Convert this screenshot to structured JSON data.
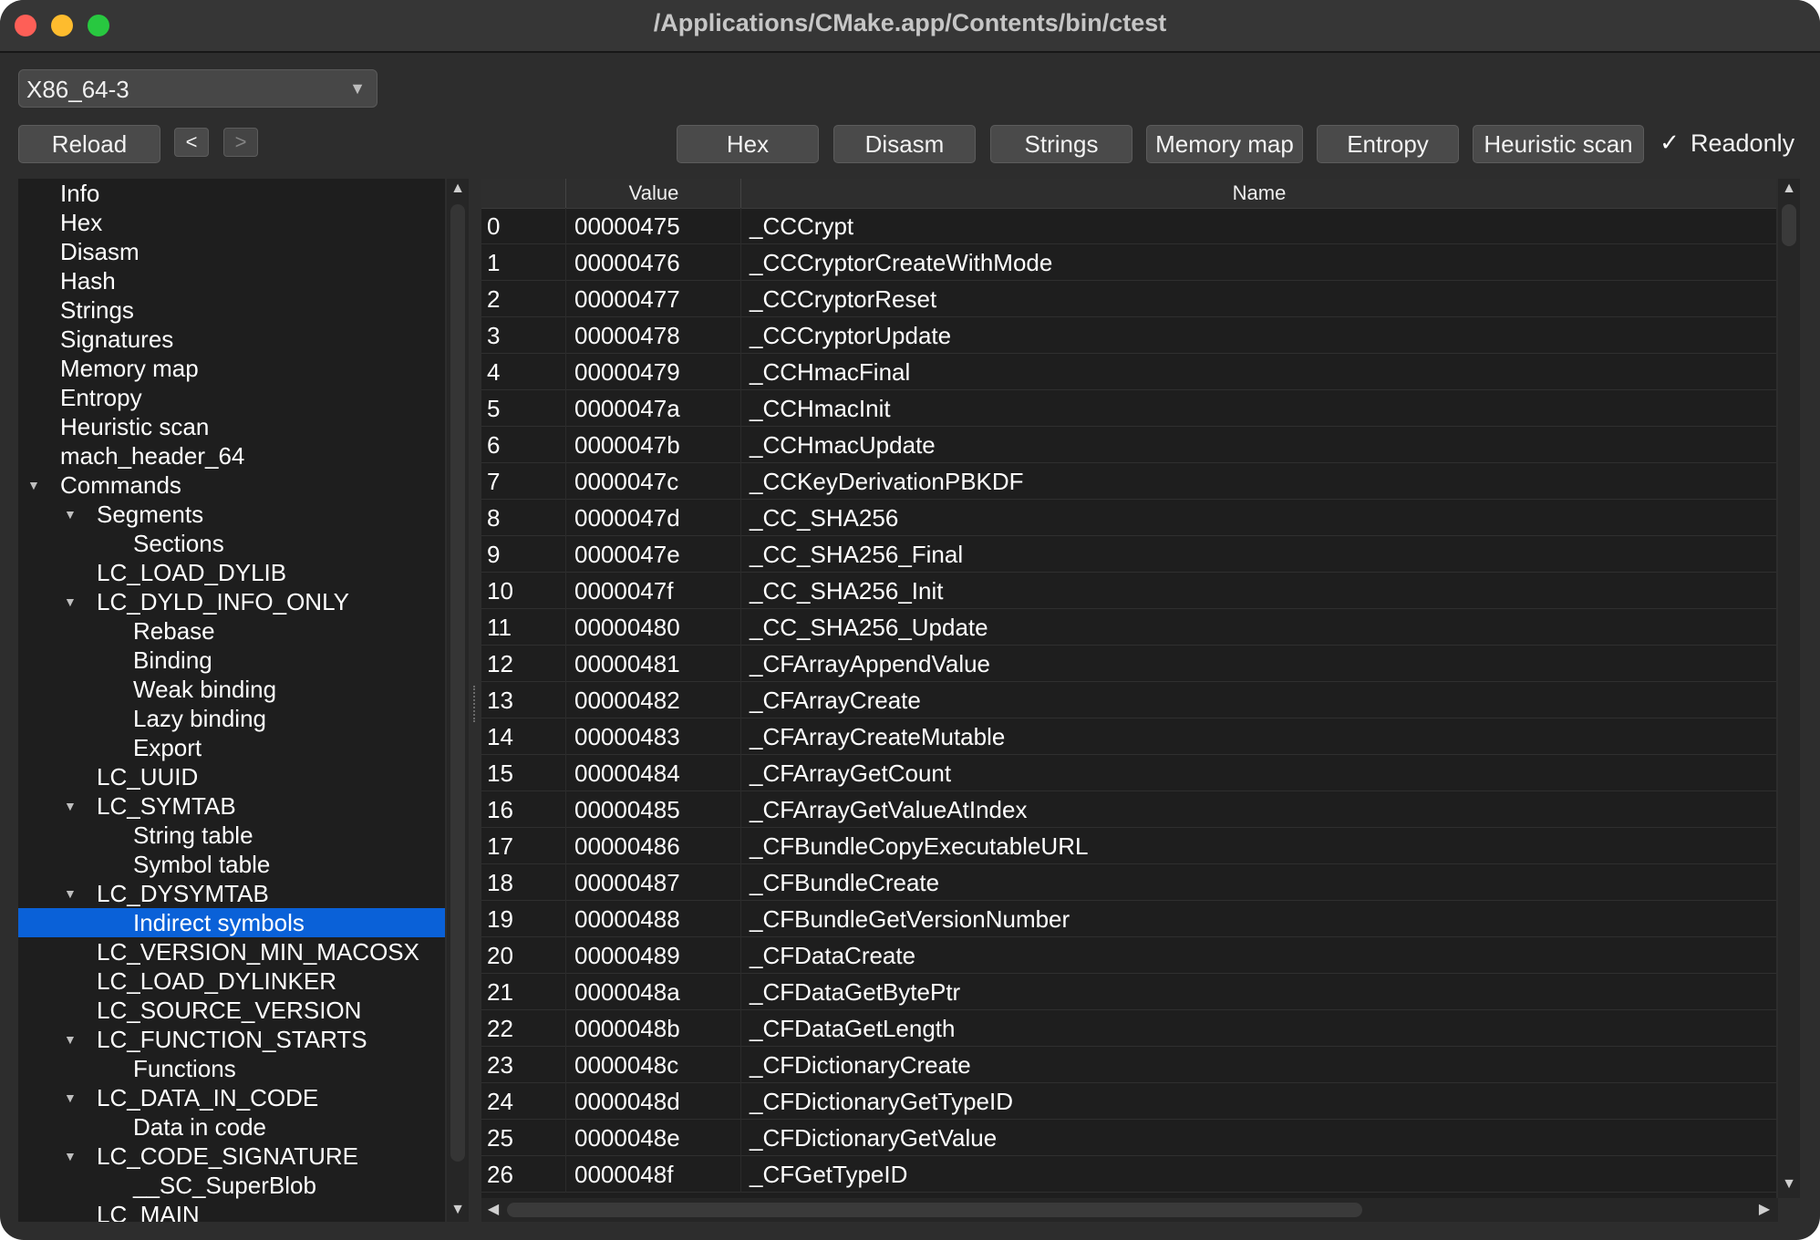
{
  "window": {
    "title": "/Applications/CMake.app/Contents/bin/ctest",
    "traffic_light_colors": [
      "#fe5f57",
      "#febc2e",
      "#28c840"
    ]
  },
  "toolbar": {
    "arch_select": "X86_64-3",
    "reload": "Reload",
    "back": "<",
    "forward": ">",
    "hex": "Hex",
    "disasm": "Disasm",
    "strings": "Strings",
    "memory_map": "Memory map",
    "entropy": "Entropy",
    "heuristic_scan": "Heuristic scan",
    "readonly_check": "✓",
    "readonly_label": "Readonly"
  },
  "tree": [
    {
      "label": "Info",
      "level": 0
    },
    {
      "label": "Hex",
      "level": 0
    },
    {
      "label": "Disasm",
      "level": 0
    },
    {
      "label": "Hash",
      "level": 0
    },
    {
      "label": "Strings",
      "level": 0
    },
    {
      "label": "Signatures",
      "level": 0
    },
    {
      "label": "Memory map",
      "level": 0
    },
    {
      "label": "Entropy",
      "level": 0
    },
    {
      "label": "Heuristic scan",
      "level": 0
    },
    {
      "label": "mach_header_64",
      "level": 0
    },
    {
      "label": "Commands",
      "level": 0,
      "expanded": true
    },
    {
      "label": "Segments",
      "level": 1,
      "expanded": true
    },
    {
      "label": "Sections",
      "level": 2
    },
    {
      "label": "LC_LOAD_DYLIB",
      "level": 1
    },
    {
      "label": "LC_DYLD_INFO_ONLY",
      "level": 1,
      "expanded": true
    },
    {
      "label": "Rebase",
      "level": 2
    },
    {
      "label": "Binding",
      "level": 2
    },
    {
      "label": "Weak binding",
      "level": 2
    },
    {
      "label": "Lazy binding",
      "level": 2
    },
    {
      "label": "Export",
      "level": 2
    },
    {
      "label": "LC_UUID",
      "level": 1
    },
    {
      "label": "LC_SYMTAB",
      "level": 1,
      "expanded": true
    },
    {
      "label": "String table",
      "level": 2
    },
    {
      "label": "Symbol table",
      "level": 2
    },
    {
      "label": "LC_DYSYMTAB",
      "level": 1,
      "expanded": true
    },
    {
      "label": "Indirect symbols",
      "level": 2,
      "selected": true
    },
    {
      "label": "LC_VERSION_MIN_MACOSX",
      "level": 1
    },
    {
      "label": "LC_LOAD_DYLINKER",
      "level": 1
    },
    {
      "label": "LC_SOURCE_VERSION",
      "level": 1
    },
    {
      "label": "LC_FUNCTION_STARTS",
      "level": 1,
      "expanded": true
    },
    {
      "label": "Functions",
      "level": 2
    },
    {
      "label": "LC_DATA_IN_CODE",
      "level": 1,
      "expanded": true
    },
    {
      "label": "Data in code",
      "level": 2
    },
    {
      "label": "LC_CODE_SIGNATURE",
      "level": 1,
      "expanded": true
    },
    {
      "label": "__SC_SuperBlob",
      "level": 2
    },
    {
      "label": "LC_MAIN",
      "level": 1
    }
  ],
  "table": {
    "columns": [
      "",
      "Value",
      "Name"
    ],
    "rows": [
      [
        "0",
        "00000475",
        "_CCCrypt"
      ],
      [
        "1",
        "00000476",
        "_CCCryptorCreateWithMode"
      ],
      [
        "2",
        "00000477",
        "_CCCryptorReset"
      ],
      [
        "3",
        "00000478",
        "_CCCryptorUpdate"
      ],
      [
        "4",
        "00000479",
        "_CCHmacFinal"
      ],
      [
        "5",
        "0000047a",
        "_CCHmacInit"
      ],
      [
        "6",
        "0000047b",
        "_CCHmacUpdate"
      ],
      [
        "7",
        "0000047c",
        "_CCKeyDerivationPBKDF"
      ],
      [
        "8",
        "0000047d",
        "_CC_SHA256"
      ],
      [
        "9",
        "0000047e",
        "_CC_SHA256_Final"
      ],
      [
        "10",
        "0000047f",
        "_CC_SHA256_Init"
      ],
      [
        "11",
        "00000480",
        "_CC_SHA256_Update"
      ],
      [
        "12",
        "00000481",
        "_CFArrayAppendValue"
      ],
      [
        "13",
        "00000482",
        "_CFArrayCreate"
      ],
      [
        "14",
        "00000483",
        "_CFArrayCreateMutable"
      ],
      [
        "15",
        "00000484",
        "_CFArrayGetCount"
      ],
      [
        "16",
        "00000485",
        "_CFArrayGetValueAtIndex"
      ],
      [
        "17",
        "00000486",
        "_CFBundleCopyExecutableURL"
      ],
      [
        "18",
        "00000487",
        "_CFBundleCreate"
      ],
      [
        "19",
        "00000488",
        "_CFBundleGetVersionNumber"
      ],
      [
        "20",
        "00000489",
        "_CFDataCreate"
      ],
      [
        "21",
        "0000048a",
        "_CFDataGetBytePtr"
      ],
      [
        "22",
        "0000048b",
        "_CFDataGetLength"
      ],
      [
        "23",
        "0000048c",
        "_CFDictionaryCreate"
      ],
      [
        "24",
        "0000048d",
        "_CFDictionaryGetTypeID"
      ],
      [
        "25",
        "0000048e",
        "_CFDictionaryGetValue"
      ],
      [
        "26",
        "0000048f",
        "_CFGetTypeID"
      ]
    ]
  },
  "scroll_icons": {
    "up": "▲",
    "down": "▼",
    "left": "◀",
    "right": "▶",
    "expanded": "▼"
  }
}
